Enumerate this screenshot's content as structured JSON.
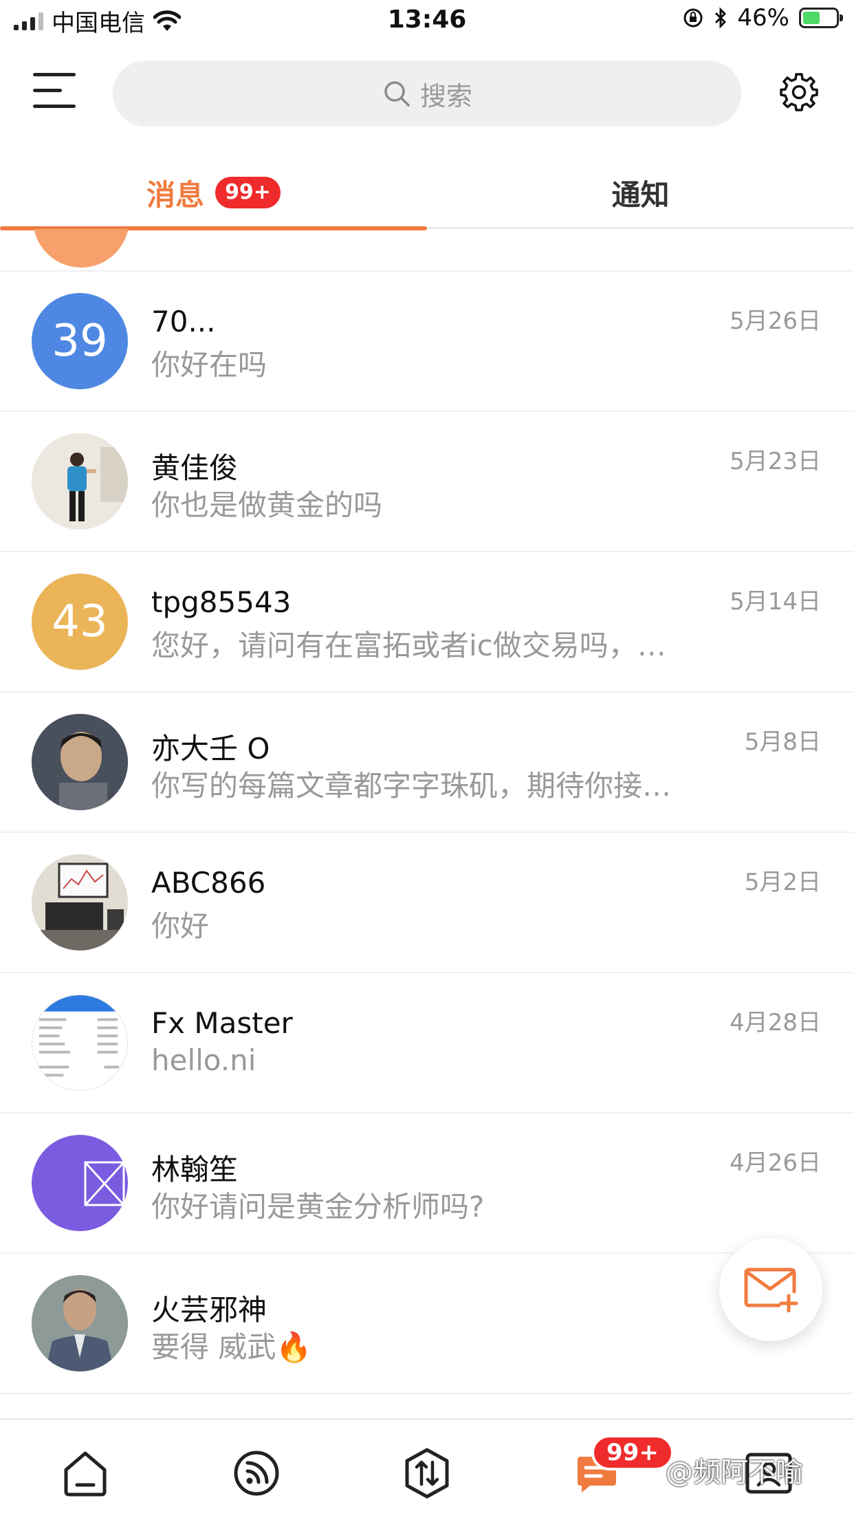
{
  "status_bar": {
    "carrier": "中国电信",
    "time": "13:46",
    "battery": "46%",
    "battery_level": 0.46
  },
  "header": {
    "search_placeholder": "搜索"
  },
  "tabs": {
    "messages_label": "消息",
    "messages_badge": "99+",
    "notifications_label": "通知"
  },
  "conversations": [
    {
      "name": "70...",
      "preview": "你好在吗",
      "date": "5月26日",
      "avatar_text": "39",
      "avatar_color": "#4f88e3"
    },
    {
      "name": "黄佳俊",
      "preview": "你也是做黄金的吗",
      "date": "5月23日",
      "avatar_icon": "person-photo"
    },
    {
      "name": "tpg85543",
      "preview": "您好，请问有在富拓或者ic做交易吗，…",
      "date": "5月14日",
      "avatar_text": "43",
      "avatar_color": "#ebb457"
    },
    {
      "name": "亦大壬 O",
      "preview": "你写的每篇文章都字字珠矶，期待你接…",
      "date": "5月8日",
      "avatar_icon": "person-photo"
    },
    {
      "name": "ABC866",
      "preview": "你好",
      "date": "5月2日",
      "avatar_icon": "desk-photo"
    },
    {
      "name": "Fx Master",
      "preview": "hello.ni",
      "date": "4月28日",
      "avatar_icon": "screenshot-photo"
    },
    {
      "name": "林翰笙",
      "preview": "你好请问是黄金分析师吗?",
      "date": "4月26日",
      "avatar_icon": "broken-image-icon",
      "avatar_color": "#7b5be0"
    },
    {
      "name": "火芸邪神",
      "preview": "要得 威武🔥",
      "date": "",
      "avatar_icon": "person-photo"
    }
  ],
  "bottom_nav": {
    "messages_badge": "99+",
    "watermark": "@频阿不喻"
  },
  "colors": {
    "accent": "#f07b3f",
    "badge": "#ef2b2b"
  }
}
